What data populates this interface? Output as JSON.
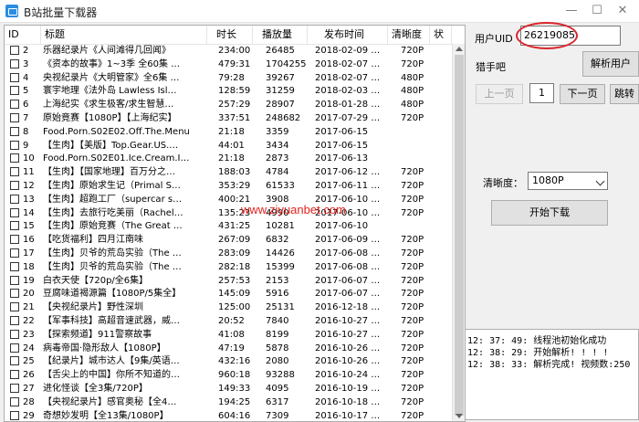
{
  "window": {
    "title": "B站批量下载器",
    "min": "—",
    "max": "☐",
    "close": "✕"
  },
  "list": {
    "columns": [
      "ID",
      "标题",
      "时长",
      "播放量",
      "发布时间",
      "清晰度",
      "状"
    ],
    "rows": [
      {
        "id": "2",
        "title": "乐器纪录片《人间滩得几回闻》",
        "duration": "234:00",
        "plays": "26485",
        "date": "2018-02-09 …",
        "quality": "720P"
      },
      {
        "id": "3",
        "title": "《资本的故事》1~3季 全60集 …",
        "duration": "479:31",
        "plays": "1704255",
        "date": "2018-02-07 …",
        "quality": "720P"
      },
      {
        "id": "4",
        "title": "央视纪录片《大明管家》全6集 …",
        "duration": "79:28",
        "plays": "39267",
        "date": "2018-02-07 …",
        "quality": "480P"
      },
      {
        "id": "5",
        "title": "寰宇地理《法外岛 Lawless Isl…",
        "duration": "128:59",
        "plays": "31259",
        "date": "2018-02-03 …",
        "quality": "480P"
      },
      {
        "id": "6",
        "title": "上海纪实《求生极客/求生智慧…",
        "duration": "257:29",
        "plays": "28907",
        "date": "2018-01-28 …",
        "quality": "480P"
      },
      {
        "id": "7",
        "title": "原始竟赛【1080P】【上海纪实】",
        "duration": "337:51",
        "plays": "248682",
        "date": "2017-07-29 …",
        "quality": "720P"
      },
      {
        "id": "8",
        "title": "Food.Porn.S02E02.Off.The.Menu",
        "duration": "21:18",
        "plays": "3359",
        "date": "2017-06-15",
        "quality": ""
      },
      {
        "id": "9",
        "title": "【生肉】【美版】Top.Gear.US.…",
        "duration": "44:01",
        "plays": "3434",
        "date": "2017-06-15",
        "quality": ""
      },
      {
        "id": "10",
        "title": "Food.Porn.S02E01.Ice.Cream.I…",
        "duration": "21:18",
        "plays": "2873",
        "date": "2017-06-13",
        "quality": ""
      },
      {
        "id": "11",
        "title": "【生肉】【国家地理】百万分之…",
        "duration": "188:03",
        "plays": "4784",
        "date": "2017-06-12 …",
        "quality": "720P"
      },
      {
        "id": "12",
        "title": "【生肉】原始求生记（Primal S…",
        "duration": "353:29",
        "plays": "61533",
        "date": "2017-06-11 …",
        "quality": "720P"
      },
      {
        "id": "13",
        "title": "【生肉】超跑工厂（supercar s…",
        "duration": "400:21",
        "plays": "3908",
        "date": "2017-06-10 …",
        "quality": "720P"
      },
      {
        "id": "14",
        "title": "【生肉】去旅行吃美丽（Rachel…",
        "duration": "135:23",
        "plays": "4990",
        "date": "2017-06-10 …",
        "quality": "720P"
      },
      {
        "id": "15",
        "title": "【生肉】原始竞赛（The Great …",
        "duration": "431:25",
        "plays": "10281",
        "date": "2017-06-10",
        "quality": ""
      },
      {
        "id": "16",
        "title": "【吃货福利】四月江南味",
        "duration": "267:09",
        "plays": "6832",
        "date": "2017-06-09 …",
        "quality": "720P"
      },
      {
        "id": "17",
        "title": "【生肉】贝爷的荒岛实验（The …",
        "duration": "283:09",
        "plays": "14426",
        "date": "2017-06-08 …",
        "quality": "720P"
      },
      {
        "id": "18",
        "title": "【生肉】贝爷的荒岛实验（The …",
        "duration": "282:18",
        "plays": "15399",
        "date": "2017-06-08 …",
        "quality": "720P"
      },
      {
        "id": "19",
        "title": "白衣天使【720p/全6集】",
        "duration": "257:53",
        "plays": "2153",
        "date": "2017-06-07 …",
        "quality": "720P"
      },
      {
        "id": "20",
        "title": "豆腐味道褐源篇【1080P/5集全】",
        "duration": "145:09",
        "plays": "5916",
        "date": "2017-06-07 …",
        "quality": "720P"
      },
      {
        "id": "21",
        "title": "【央视纪录片】野性深圳",
        "duration": "125:00",
        "plays": "25131",
        "date": "2016-12-18 …",
        "quality": "720P"
      },
      {
        "id": "22",
        "title": "【军事科技】高超音速武器，威…",
        "duration": "20:52",
        "plays": "7840",
        "date": "2016-10-27 …",
        "quality": "720P"
      },
      {
        "id": "23",
        "title": "【探索频道】911警察故事",
        "duration": "41:08",
        "plays": "8199",
        "date": "2016-10-27 …",
        "quality": "720P"
      },
      {
        "id": "24",
        "title": "病毒帝国·隐形敌人【1080P】",
        "duration": "47:19",
        "plays": "5878",
        "date": "2016-10-26 …",
        "quality": "720P"
      },
      {
        "id": "25",
        "title": "【纪录片】城市达人【9集/英语…",
        "duration": "432:16",
        "plays": "2080",
        "date": "2016-10-26 …",
        "quality": "720P"
      },
      {
        "id": "26",
        "title": "【舌尖上的中国】你所不知道的…",
        "duration": "960:18",
        "plays": "93288",
        "date": "2016-10-24 …",
        "quality": "720P"
      },
      {
        "id": "27",
        "title": "进化怪谈【全3集/720P】",
        "duration": "149:33",
        "plays": "4095",
        "date": "2016-10-19 …",
        "quality": "720P"
      },
      {
        "id": "28",
        "title": "【央视纪录片】感官奥秘【全4…",
        "duration": "194:25",
        "plays": "6317",
        "date": "2016-10-18 …",
        "quality": "720P"
      },
      {
        "id": "29",
        "title": "奇想妙发明【全13集/1080P】",
        "duration": "604:16",
        "plays": "7309",
        "date": "2016-10-17 …",
        "quality": "720P"
      }
    ]
  },
  "panel": {
    "uid_label": "用户UID",
    "uid_value": "26219085",
    "user_name": "猎手吧",
    "parse_user": "解析用户",
    "prev_page": "上一页",
    "page_number": "1",
    "next_page": "下一页",
    "jump": "跳转",
    "quality_label": "清晰度：",
    "quality_value": "1080P",
    "start_download": "开始下载"
  },
  "watermark": "www.ziyuanbet.com",
  "log": [
    "12: 37: 49: 线程池初始化成功",
    "12: 38: 29: 开始解析! ! ! !",
    "12: 38: 33: 解析完成! 视频数:250"
  ],
  "colors": {
    "highlight_ring": "#d8262c",
    "watermark": "#e1241f"
  }
}
